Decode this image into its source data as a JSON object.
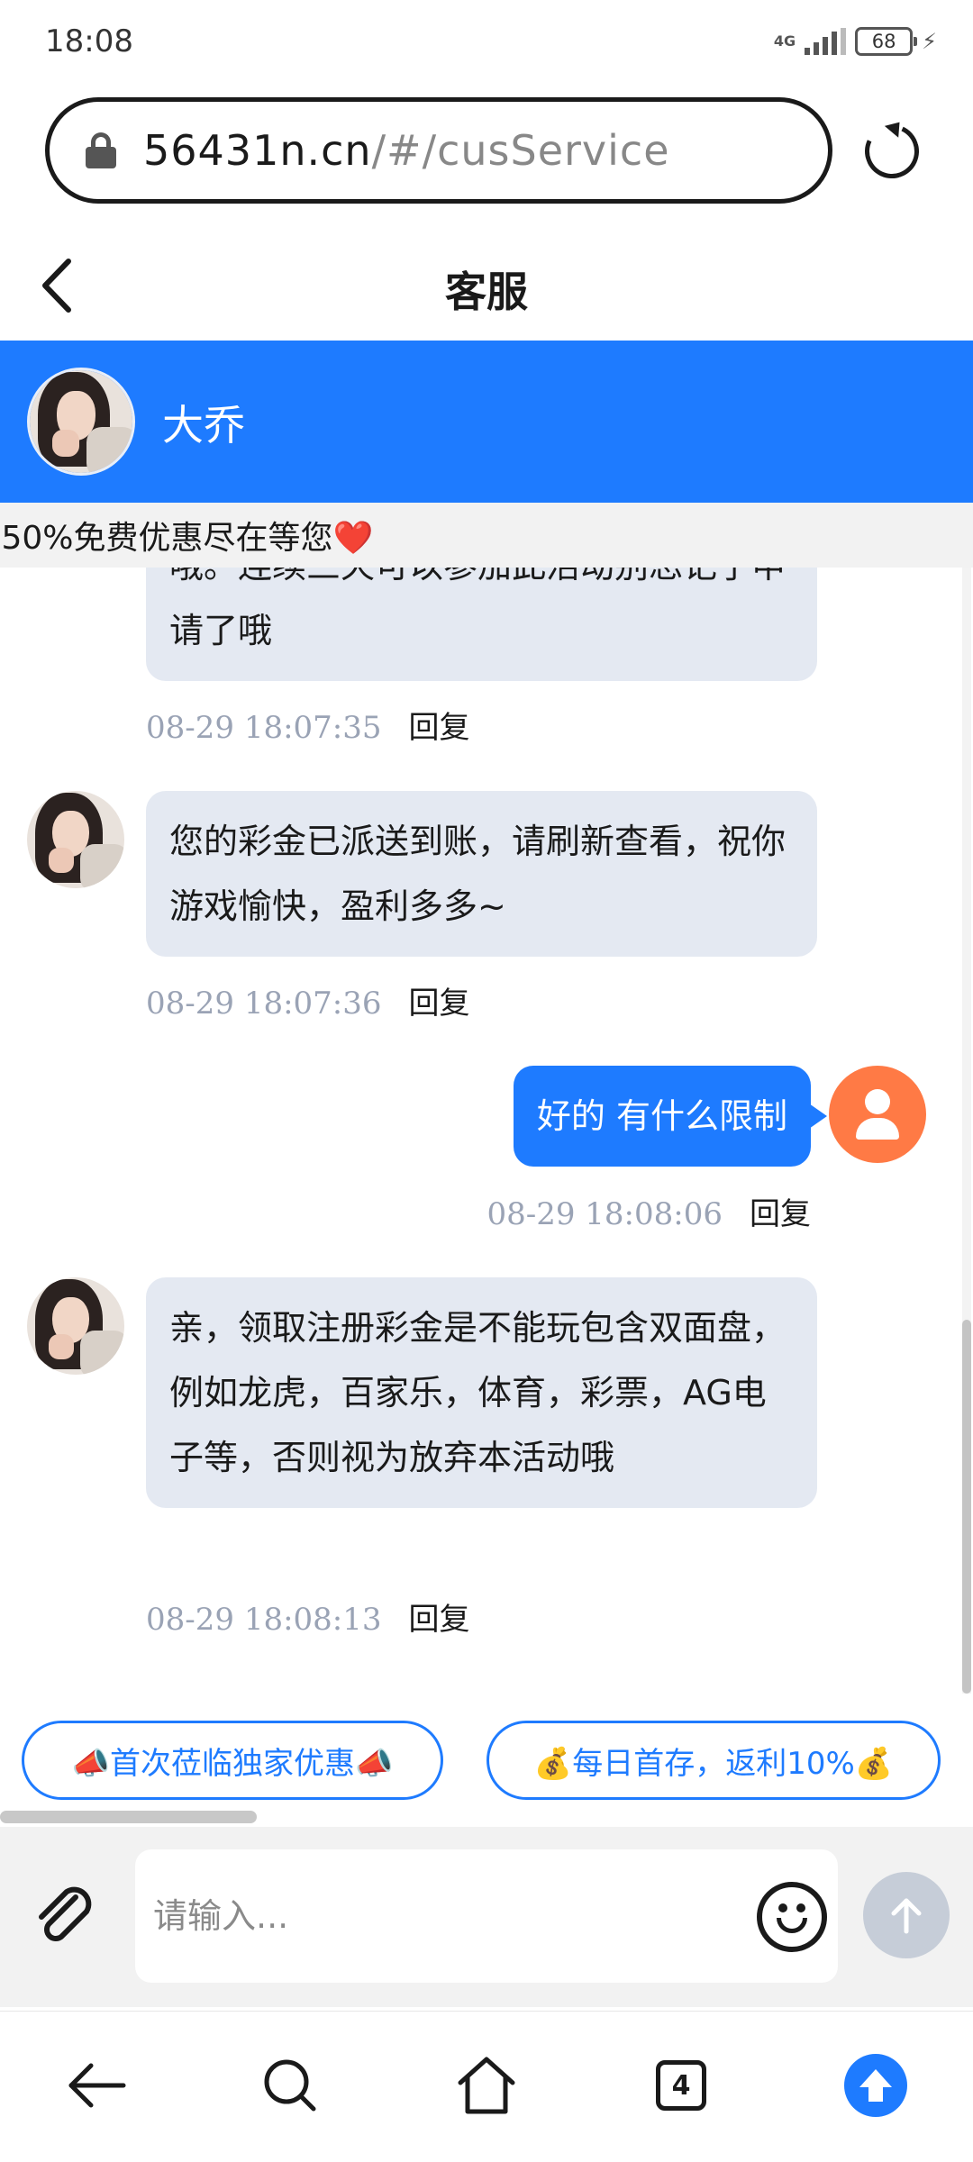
{
  "status_bar": {
    "time": "18:08",
    "network": "4G",
    "battery": "68"
  },
  "browser": {
    "url_host": "56431n.cn",
    "url_path": "/#/cusService"
  },
  "header": {
    "title": "客服"
  },
  "agent": {
    "name": "大乔"
  },
  "marquee": {
    "text": ".50%免费优惠尽在等您",
    "emoji": "❤️"
  },
  "messages": [
    {
      "side": "agent",
      "text": "哦。连续三天可以参加此活动别忘记了申请了哦",
      "time": "08-29 18:07:35",
      "reply": "回复"
    },
    {
      "side": "agent",
      "text": "您的彩金已派送到账，请刷新查看，祝你游戏愉快，盈利多多~",
      "time": "08-29 18:07:36",
      "reply": "回复"
    },
    {
      "side": "user",
      "text": "好的 有什么限制",
      "time": "08-29 18:08:06",
      "reply": "回复"
    },
    {
      "side": "agent",
      "text": "亲，领取注册彩金是不能玩包含双面盘，例如龙虎，百家乐，体育，彩票，AG电子等，否则视为放弃本活动哦",
      "time": "08-29 18:08:13",
      "reply": "回复"
    }
  ],
  "quick_replies": [
    {
      "label": "📣首次莅临独家优惠📣"
    },
    {
      "label": "💰每日首存，返利10%💰"
    }
  ],
  "input": {
    "placeholder": "请输入..."
  },
  "browser_nav": {
    "tabs_count": "4"
  }
}
